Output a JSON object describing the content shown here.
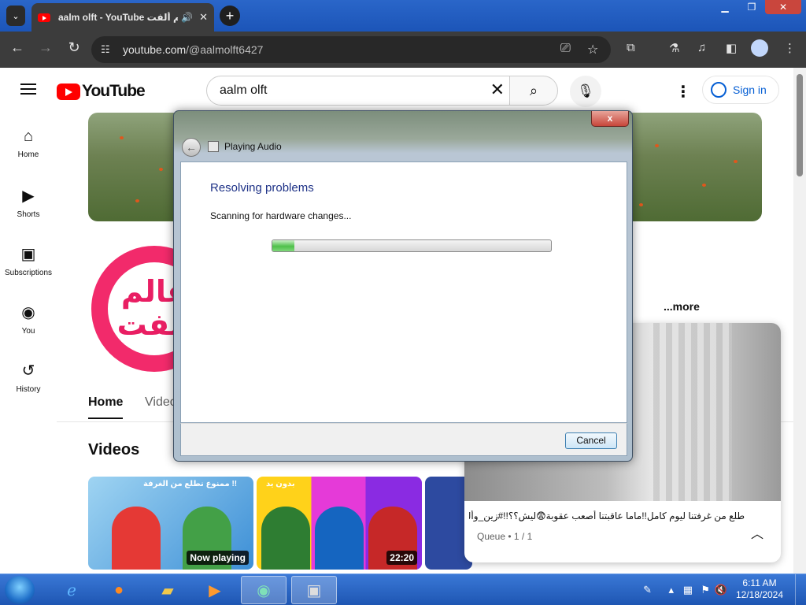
{
  "browser": {
    "tab_title": "aalm olft - YouTube عالم ألفت",
    "new_tab": "+",
    "url_host": "youtube.com",
    "url_path": "/@aalmolft6427"
  },
  "youtube": {
    "logo_text": "YouTube",
    "search_value": "aalm olft",
    "sign_in": "Sign in",
    "sidebar": [
      {
        "label": "Home",
        "icon": "home-icon",
        "glyph": "⌂"
      },
      {
        "label": "Shorts",
        "icon": "shorts-icon",
        "glyph": "▶"
      },
      {
        "label": "Subscriptions",
        "icon": "subscriptions-icon",
        "glyph": "▣"
      },
      {
        "label": "You",
        "icon": "you-icon",
        "glyph": "◉"
      },
      {
        "label": "History",
        "icon": "history-icon",
        "glyph": "↺"
      }
    ],
    "channel_avatar_text": "عالم ألفت",
    "more_link": "...more",
    "tabs": {
      "active": "Home",
      "other": "Video"
    },
    "section_title": "Videos",
    "thumbs": [
      {
        "caption": "ممنوع نطلع من الغرفة !!",
        "badge": "Now playing"
      },
      {
        "caption": "بدون يد",
        "badge": "22:20"
      }
    ]
  },
  "miniplayer": {
    "title": "طلع من غرفتنا ليوم كامل!!ماما عاقبتنا أصعب عقوبة😨ليش؟؟!!#زين_وألفت",
    "queue": "Queue • 1 / 1"
  },
  "dialog": {
    "window_title": "Playing Audio",
    "heading": "Resolving problems",
    "status": "Scanning for hardware changes...",
    "progress_fraction": 0.08,
    "cancel": "Cancel",
    "close": "x"
  },
  "taskbar": {
    "time": "6:11 AM",
    "date": "12/18/2024"
  }
}
